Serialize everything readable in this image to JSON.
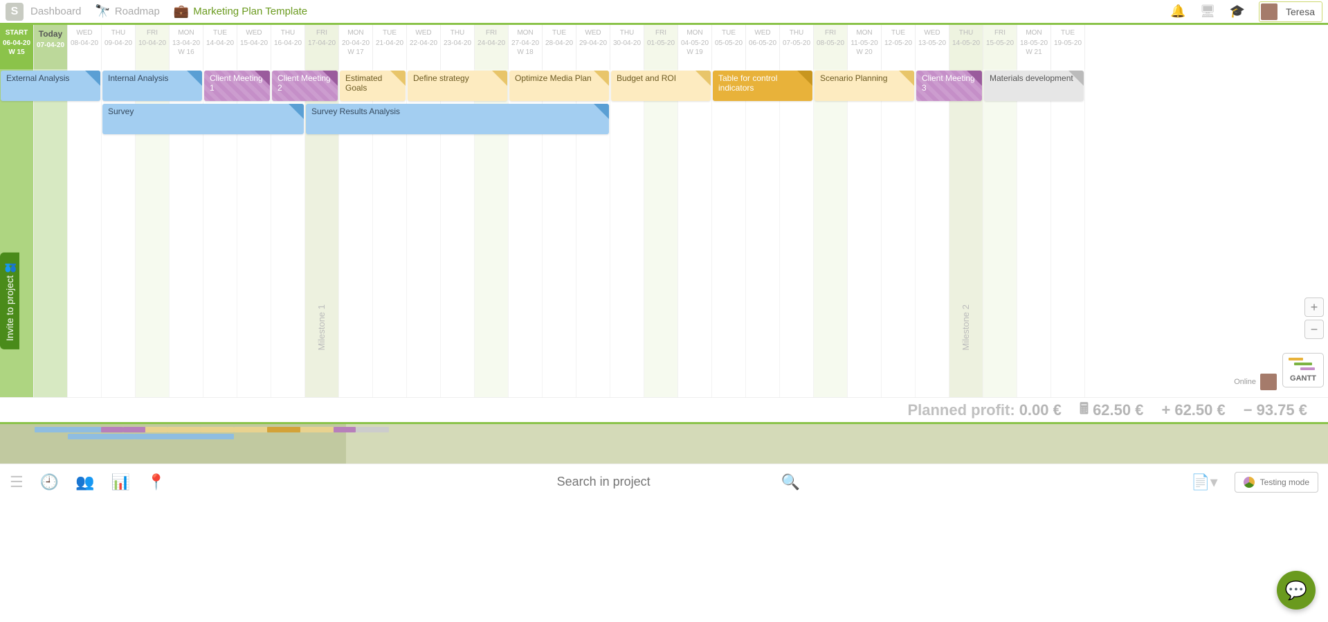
{
  "header": {
    "nav": [
      {
        "label": "Dashboard",
        "icon": "S"
      },
      {
        "label": "Roadmap"
      },
      {
        "label": "Marketing Plan Template"
      }
    ],
    "user": "Teresa"
  },
  "timeline": {
    "columns": [
      {
        "dow": "START",
        "date": "06-04-20",
        "week": "W 15",
        "cls": "start"
      },
      {
        "dow": "Today",
        "date": "07-04-20",
        "week": "",
        "cls": "today"
      },
      {
        "dow": "WED",
        "date": "08-04-20",
        "week": ""
      },
      {
        "dow": "THU",
        "date": "09-04-20",
        "week": ""
      },
      {
        "dow": "FRI",
        "date": "10-04-20",
        "week": "",
        "cls": "weekend"
      },
      {
        "dow": "MON",
        "date": "13-04-20",
        "week": "W 16"
      },
      {
        "dow": "TUE",
        "date": "14-04-20",
        "week": ""
      },
      {
        "dow": "WED",
        "date": "15-04-20",
        "week": ""
      },
      {
        "dow": "THU",
        "date": "16-04-20",
        "week": ""
      },
      {
        "dow": "FRI",
        "date": "17-04-20",
        "week": "",
        "cls": "milestone-col"
      },
      {
        "dow": "MON",
        "date": "20-04-20",
        "week": "W 17"
      },
      {
        "dow": "TUE",
        "date": "21-04-20",
        "week": ""
      },
      {
        "dow": "WED",
        "date": "22-04-20",
        "week": ""
      },
      {
        "dow": "THU",
        "date": "23-04-20",
        "week": ""
      },
      {
        "dow": "FRI",
        "date": "24-04-20",
        "week": "",
        "cls": "weekend"
      },
      {
        "dow": "MON",
        "date": "27-04-20",
        "week": "W 18"
      },
      {
        "dow": "TUE",
        "date": "28-04-20",
        "week": ""
      },
      {
        "dow": "WED",
        "date": "29-04-20",
        "week": ""
      },
      {
        "dow": "THU",
        "date": "30-04-20",
        "week": ""
      },
      {
        "dow": "FRI",
        "date": "01-05-20",
        "week": "",
        "cls": "weekend"
      },
      {
        "dow": "MON",
        "date": "04-05-20",
        "week": "W 19"
      },
      {
        "dow": "TUE",
        "date": "05-05-20",
        "week": ""
      },
      {
        "dow": "WED",
        "date": "06-05-20",
        "week": ""
      },
      {
        "dow": "THU",
        "date": "07-05-20",
        "week": ""
      },
      {
        "dow": "FRI",
        "date": "08-05-20",
        "week": "",
        "cls": "weekend"
      },
      {
        "dow": "MON",
        "date": "11-05-20",
        "week": "W 20"
      },
      {
        "dow": "TUE",
        "date": "12-05-20",
        "week": ""
      },
      {
        "dow": "WED",
        "date": "13-05-20",
        "week": ""
      },
      {
        "dow": "THU",
        "date": "14-05-20",
        "week": "",
        "cls": "milestone-col"
      },
      {
        "dow": "FRI",
        "date": "15-05-20",
        "week": "",
        "cls": "weekend"
      },
      {
        "dow": "MON",
        "date": "18-05-20",
        "week": "W 21"
      },
      {
        "dow": "TUE",
        "date": "19-05-20",
        "week": ""
      }
    ],
    "milestones": [
      {
        "label": "Milestone 1",
        "col": 9
      },
      {
        "label": "Milestone 2",
        "col": 28
      }
    ]
  },
  "tasks": [
    {
      "label": "External Analysis",
      "startCol": 0,
      "span": 3,
      "row": 0,
      "cls": "t-blue"
    },
    {
      "label": "Internal Analysis",
      "startCol": 3,
      "span": 3,
      "row": 0,
      "cls": "t-blue"
    },
    {
      "label": "Client Meeting 1",
      "startCol": 6,
      "span": 2,
      "row": 0,
      "cls": "t-purple"
    },
    {
      "label": "Client Meeting 2",
      "startCol": 8,
      "span": 2,
      "row": 0,
      "cls": "t-purple"
    },
    {
      "label": "Estimated Goals",
      "startCol": 10,
      "span": 2,
      "row": 0,
      "cls": "t-yellow"
    },
    {
      "label": "Define strategy",
      "startCol": 12,
      "span": 3,
      "row": 0,
      "cls": "t-yellow"
    },
    {
      "label": "Optimize Media Plan",
      "startCol": 15,
      "span": 3,
      "row": 0,
      "cls": "t-yellow"
    },
    {
      "label": "Budget and ROI",
      "startCol": 18,
      "span": 3,
      "row": 0,
      "cls": "t-yellow"
    },
    {
      "label": "Table for control indicators",
      "startCol": 21,
      "span": 3,
      "row": 0,
      "cls": "t-orange"
    },
    {
      "label": "Scenario Planning",
      "startCol": 24,
      "span": 3,
      "row": 0,
      "cls": "t-yellow"
    },
    {
      "label": "Client Meeting 3",
      "startCol": 27,
      "span": 2,
      "row": 0,
      "cls": "t-purple"
    },
    {
      "label": "Materials development",
      "startCol": 29,
      "span": 3,
      "row": 0,
      "cls": "t-gray"
    },
    {
      "label": "Survey",
      "startCol": 3,
      "span": 6,
      "row": 1,
      "cls": "t-blue"
    },
    {
      "label": "Survey Results Analysis",
      "startCol": 9,
      "span": 9,
      "row": 1,
      "cls": "t-blue"
    }
  ],
  "profit": {
    "planned_label": "Planned profit:",
    "planned": "0.00 €",
    "calc": "62.50 €",
    "plus": "62.50 €",
    "minus": "93.75 €"
  },
  "invite_label": "Invite to project",
  "footer": {
    "search_placeholder": "Search in project",
    "testing_label": "Testing mode"
  },
  "gantt_label": "GANTT",
  "online_label": "Online"
}
